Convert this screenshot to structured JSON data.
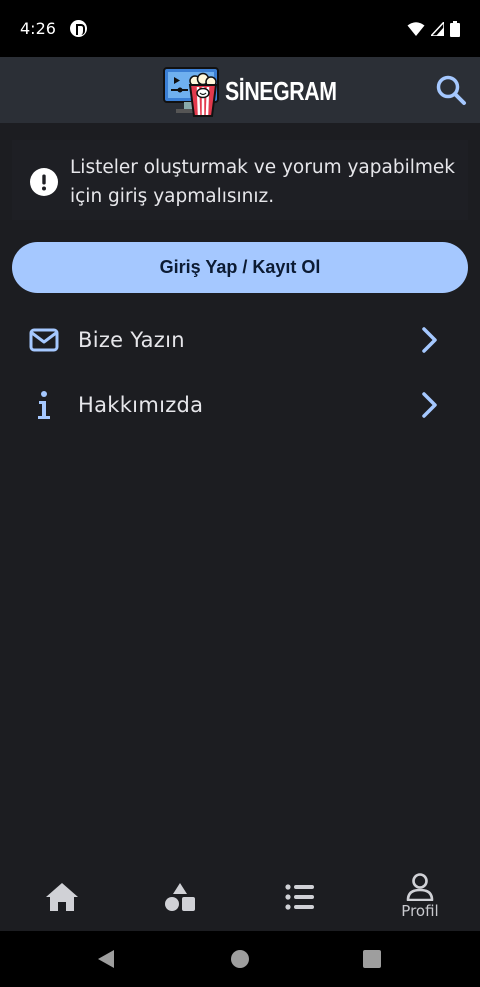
{
  "status_bar": {
    "time": "4:26"
  },
  "app_bar": {
    "logo_text": "SİNEGRAM",
    "search_icon": "search-icon"
  },
  "notice": {
    "icon": "exclamation-circle-icon",
    "text": "Listeler oluşturmak ve yorum yapabilmek için giriş yapmalısınız."
  },
  "login_button": {
    "label": "Giriş Yap / Kayıt Ol"
  },
  "menu": [
    {
      "icon": "envelope-icon",
      "label": "Bize Yazın"
    },
    {
      "icon": "info-icon",
      "label": "Hakkımızda"
    }
  ],
  "bottom_nav": {
    "items": [
      {
        "icon": "home-icon",
        "label": ""
      },
      {
        "icon": "shapes-icon",
        "label": ""
      },
      {
        "icon": "list-icon",
        "label": ""
      },
      {
        "icon": "user-icon",
        "label": "Profil",
        "active": true
      }
    ]
  },
  "colors": {
    "accent": "#a5c8ff",
    "background": "#1c1d21",
    "app_bar": "#2b2f36"
  }
}
